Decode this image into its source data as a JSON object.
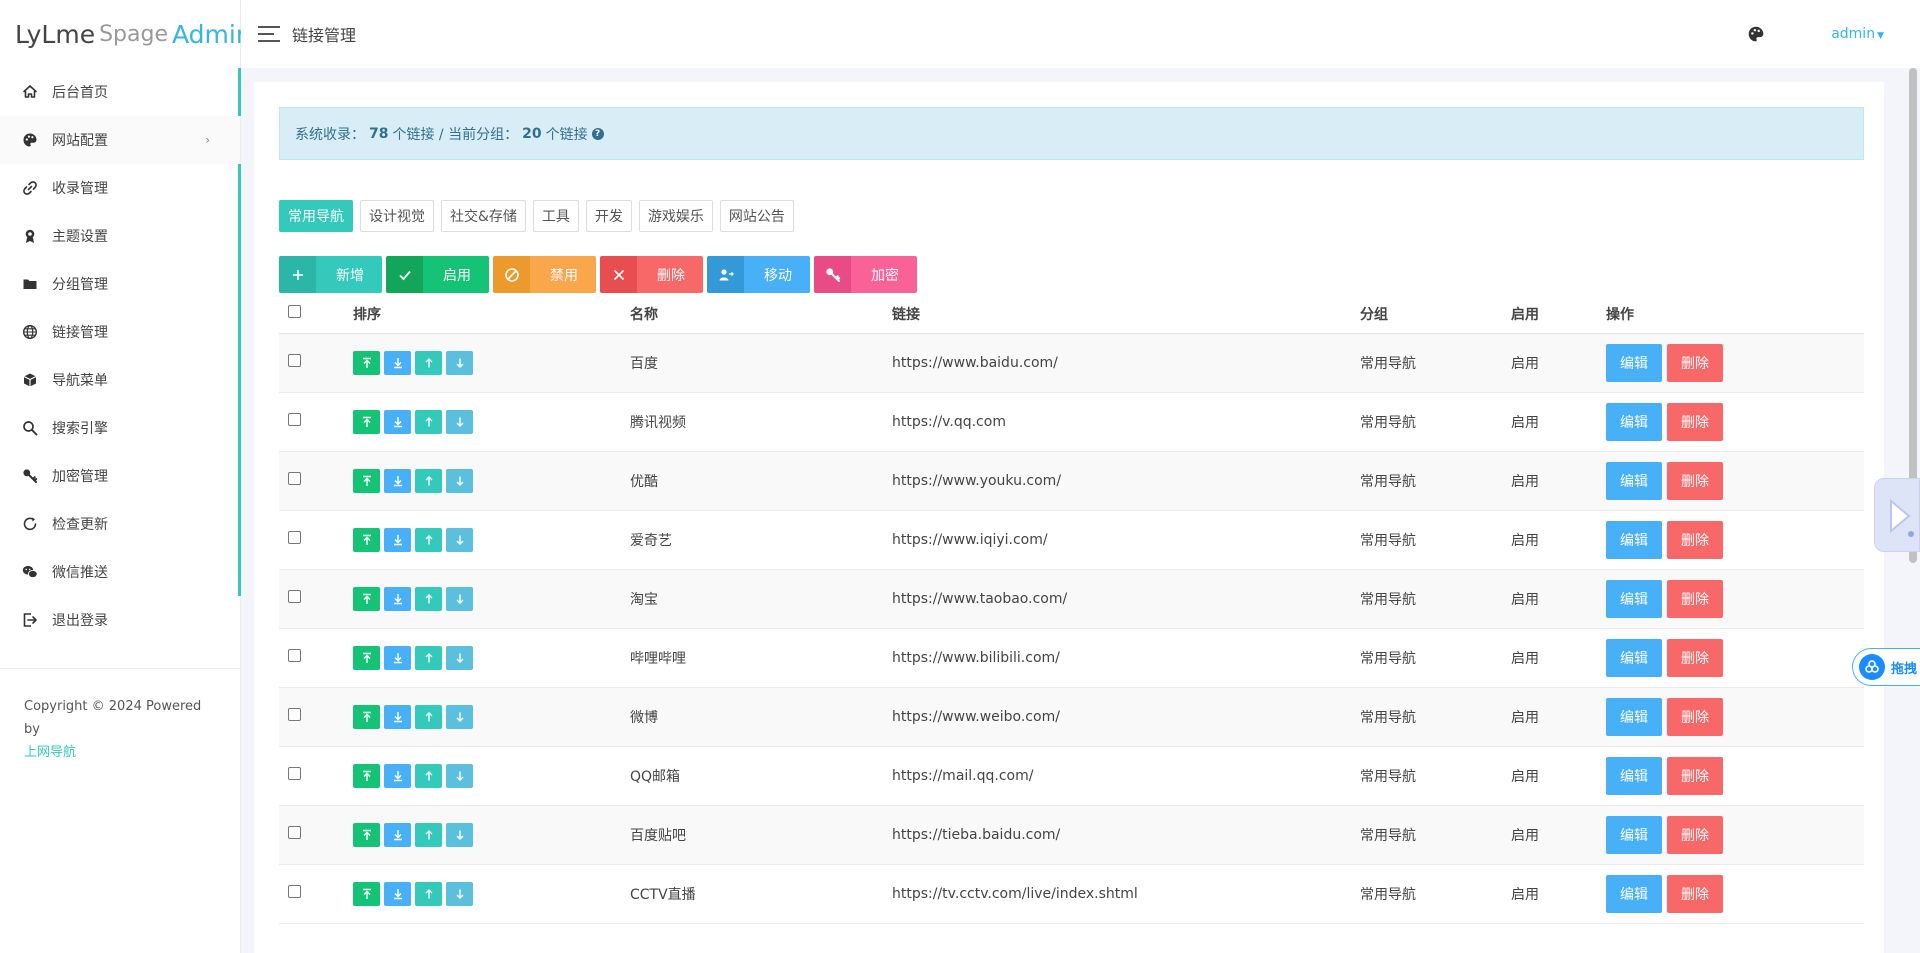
{
  "logo": {
    "part1": "LyLme",
    "part2": "Spage",
    "part3": "Admin"
  },
  "header": {
    "title": "链接管理",
    "user": "admin"
  },
  "sidebar": {
    "items": [
      {
        "label": "后台首页",
        "icon": "home-icon"
      },
      {
        "label": "网站配置",
        "icon": "palette-icon",
        "chevron": "›"
      },
      {
        "label": "收录管理",
        "icon": "link-icon"
      },
      {
        "label": "主题设置",
        "icon": "award-icon"
      },
      {
        "label": "分组管理",
        "icon": "folder-icon"
      },
      {
        "label": "链接管理",
        "icon": "globe-icon"
      },
      {
        "label": "导航菜单",
        "icon": "cube-icon"
      },
      {
        "label": "搜索引擎",
        "icon": "search-icon"
      },
      {
        "label": "加密管理",
        "icon": "key-icon"
      },
      {
        "label": "检查更新",
        "icon": "refresh-icon"
      },
      {
        "label": "微信推送",
        "icon": "wechat-icon"
      },
      {
        "label": "退出登录",
        "icon": "logout-icon"
      }
    ],
    "copyright": "Copyright © 2024 Powered by",
    "copyright_link": "上网导航"
  },
  "alert": {
    "prefix": "系统收录：",
    "total": "78",
    "mid": "个链接 / 当前分组：",
    "current": "20",
    "suffix": "个链接",
    "help": "?"
  },
  "tabs": [
    "常用导航",
    "设计视觉",
    "社交&存储",
    "工具",
    "开发",
    "游戏娱乐",
    "网站公告"
  ],
  "toolbar": {
    "add": "新增",
    "enable": "启用",
    "disable": "禁用",
    "delete": "删除",
    "move": "移动",
    "encrypt": "加密"
  },
  "table": {
    "headers": {
      "order": "排序",
      "name": "名称",
      "link": "链接",
      "group": "分组",
      "enabled": "启用",
      "ops": "操作"
    },
    "edit_label": "编辑",
    "delete_label": "删除",
    "rows": [
      {
        "name": "百度",
        "link": "https://www.baidu.com/",
        "group": "常用导航",
        "status": "启用"
      },
      {
        "name": "腾讯视频",
        "link": "https://v.qq.com",
        "group": "常用导航",
        "status": "启用"
      },
      {
        "name": "优酷",
        "link": "https://www.youku.com/",
        "group": "常用导航",
        "status": "启用"
      },
      {
        "name": "爱奇艺",
        "link": "https://www.iqiyi.com/",
        "group": "常用导航",
        "status": "启用"
      },
      {
        "name": "淘宝",
        "link": "https://www.taobao.com/",
        "group": "常用导航",
        "status": "启用"
      },
      {
        "name": "哔哩哔哩",
        "link": "https://www.bilibili.com/",
        "group": "常用导航",
        "status": "启用"
      },
      {
        "name": "微博",
        "link": "https://www.weibo.com/",
        "group": "常用导航",
        "status": "启用"
      },
      {
        "name": "QQ邮箱",
        "link": "https://mail.qq.com/",
        "group": "常用导航",
        "status": "启用"
      },
      {
        "name": "百度贴吧",
        "link": "https://tieba.baidu.com/",
        "group": "常用导航",
        "status": "启用"
      },
      {
        "name": "CCTV直播",
        "link": "https://tv.cctv.com/live/index.shtml",
        "group": "常用导航",
        "status": "启用"
      }
    ]
  },
  "float_widget": {
    "label": "拖拽"
  },
  "colors": {
    "accent": "#33cabb",
    "success": "#15c377",
    "info": "#48b0f7",
    "warning": "#faa64b",
    "danger": "#f96868",
    "pink": "#f96197"
  }
}
